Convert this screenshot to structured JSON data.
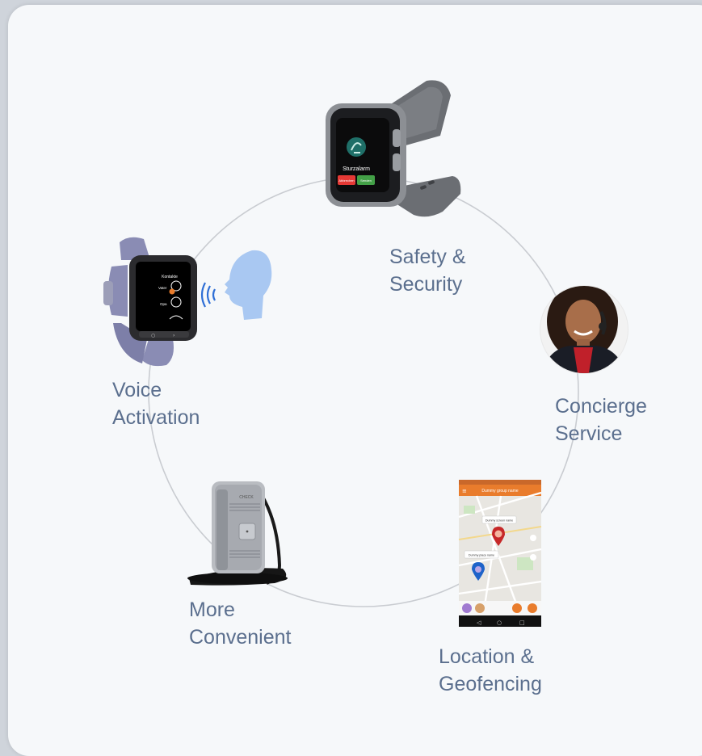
{
  "features": [
    {
      "id": "safety",
      "line1": "Safety &",
      "line2": "Security",
      "device": "smartwatch-grey-icon"
    },
    {
      "id": "concierge",
      "line1": "Concierge",
      "line2": "Service",
      "device": "concierge-agent-avatar"
    },
    {
      "id": "location",
      "line1": "Location &",
      "line2": "Geofencing",
      "device": "map-app-phone-icon"
    },
    {
      "id": "convenient",
      "line1": "More",
      "line2": "Convenient",
      "device": "pendant-tracker-icon"
    },
    {
      "id": "voice",
      "line1": "Voice",
      "line2": "Activation",
      "device": "smartwatch-purple-icon"
    }
  ],
  "watch_screen": {
    "alert_title": "Sturzalarm",
    "cancel_label": "Abbrechen",
    "send_label": "Senden"
  },
  "voice_watch_screen": {
    "header": "Kontakte",
    "contact_1": "Vater",
    "contact_2": "Opa"
  },
  "map_app": {
    "title": "Dummy group name",
    "label_user": "Dummy screen name",
    "label_place": "Dummy place name"
  },
  "pendant": {
    "brand": "CHECK"
  },
  "colors": {
    "card_bg": "#f6f8fa",
    "circle": "#c9ccd1",
    "label": "#5b6f8e",
    "app_orange": "#e97c2c",
    "alarm_red": "#e53935",
    "alarm_green": "#43a047",
    "head_blue": "#a9c8f2",
    "sound_blue": "#2f6fd6"
  }
}
